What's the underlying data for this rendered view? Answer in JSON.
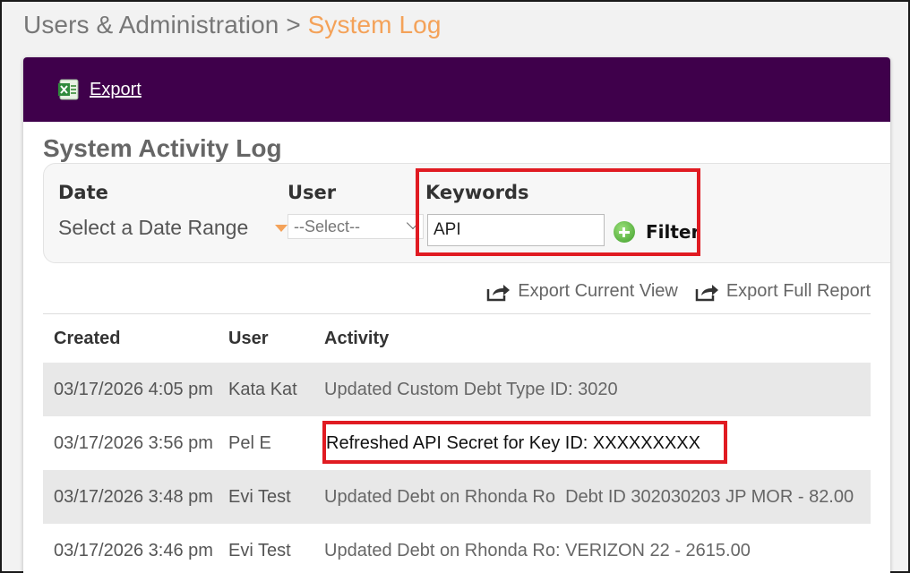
{
  "breadcrumb": {
    "parent": "Users & Administration",
    "separator": ">",
    "current": "System Log"
  },
  "colors": {
    "toolbar_bg": "#3f004b",
    "breadcrumb_accent": "#f4a259",
    "highlight_border": "#e01b22"
  },
  "toolbar": {
    "export_label": "Export",
    "export_icon": "excel-icon"
  },
  "log": {
    "title": "System Activity Log",
    "filters": {
      "date_label": "Date",
      "date_value": "Select a Date Range",
      "user_label": "User",
      "user_selected": "--Select--",
      "keywords_label": "Keywords",
      "keywords_value": "API",
      "filter_button": "Filter"
    },
    "exports": {
      "current_view": "Export Current View",
      "full_report": "Export Full Report"
    },
    "table": {
      "headers": [
        "Created",
        "User",
        "Activity"
      ],
      "rows": [
        {
          "created": "03/17/2026 4:05 pm",
          "user": "Kata Kat",
          "activity": "Updated Custom Debt Type ID: 3020"
        },
        {
          "created": "03/17/2026 3:56 pm",
          "user": "Pel E",
          "activity": "Refreshed API Secret for Key ID: XXXXXXXXX"
        },
        {
          "created": "03/17/2026 3:48 pm",
          "user": "Evi Test",
          "activity": "Updated Debt on Rhonda Ro  Debt ID 302030203 JP MOR - 82.00"
        },
        {
          "created": "03/17/2026 3:46 pm",
          "user": "Evi Test",
          "activity": "Updated Debt on Rhonda Ro: VERIZON 22 - 2615.00"
        }
      ]
    }
  }
}
